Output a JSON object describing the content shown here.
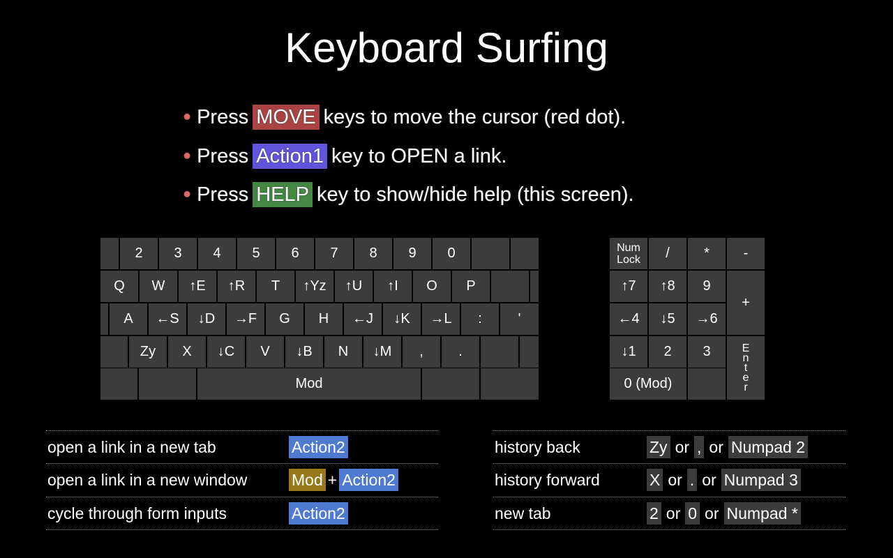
{
  "title": "Keyboard Surfing",
  "bullets": [
    {
      "prefix": "Press",
      "tag": "MOVE",
      "tag_color": "#aa4444",
      "suffix": "keys to move the cursor (red dot)."
    },
    {
      "prefix": "Press",
      "tag": "Action1",
      "tag_color": "#6155dd",
      "suffix": "key to OPEN a link."
    },
    {
      "prefix": "Press",
      "tag": "HELP",
      "tag_color": "#448844",
      "suffix": "key to show/hide help (this screen)."
    }
  ],
  "colors": {
    "move": "#aa4444",
    "action1": "#6155dd",
    "action2": "#4f7ad2",
    "help": "#448844",
    "history": "#8a8a00",
    "mod": "#987818",
    "default": "#3c3c3c"
  },
  "keyboard": {
    "row1": [
      "",
      "2",
      "3",
      "4",
      "5",
      "6",
      "7",
      "8",
      "9",
      "0",
      "",
      ""
    ],
    "row2": [
      "Q",
      "W",
      "↑E",
      "↑R",
      "T",
      "↑Yz",
      "↑U",
      "↑I",
      "O",
      "P",
      "",
      ""
    ],
    "row3": [
      "",
      "A",
      "←S",
      "↓D",
      "→F",
      "G",
      "H",
      "←J",
      "↓K",
      "→L",
      ":",
      "'"
    ],
    "row4": [
      "",
      "Zy",
      "X",
      "↓C",
      "V",
      "↓B",
      "N",
      "↓M",
      ",",
      ".",
      "",
      ""
    ],
    "row5": [
      "",
      "",
      "Mod",
      "",
      ""
    ]
  },
  "numpad": {
    "row1": [
      "Num\nLock",
      "/",
      "*",
      "-"
    ],
    "row2": [
      "↑7",
      "↑8",
      "9"
    ],
    "plus": "+",
    "row3": [
      "←4",
      "↓5",
      "→6"
    ],
    "row4": [
      "↓1",
      "2",
      "3"
    ],
    "enter": [
      "E",
      "n",
      "t",
      "e",
      "r"
    ],
    "row5": [
      "0 (Mod)",
      ""
    ]
  },
  "shortcuts_left": [
    {
      "action": "open a link in a new tab",
      "keys": [
        {
          "label": "Action2",
          "color": "#4f7ad2"
        }
      ]
    },
    {
      "action": "open a link in a new window",
      "keys": [
        {
          "label": "Mod",
          "color": "#987818"
        },
        {
          "sep": "+"
        },
        {
          "label": "Action2",
          "color": "#4f7ad2"
        }
      ]
    },
    {
      "action": "cycle through form inputs",
      "keys": [
        {
          "label": "Action2",
          "color": "#4f7ad2"
        }
      ]
    }
  ],
  "shortcuts_right": [
    {
      "action": "history back",
      "keys": [
        {
          "label": "Zy"
        },
        {
          "sep": "or"
        },
        {
          "label": ","
        },
        {
          "sep": "or"
        },
        {
          "label": "Numpad 2"
        }
      ]
    },
    {
      "action": "history forward",
      "keys": [
        {
          "label": "X"
        },
        {
          "sep": "or"
        },
        {
          "label": "."
        },
        {
          "sep": "or"
        },
        {
          "label": "Numpad 3"
        }
      ]
    },
    {
      "action": "new tab",
      "keys": [
        {
          "label": "2"
        },
        {
          "sep": "or"
        },
        {
          "label": "0"
        },
        {
          "sep": "or"
        },
        {
          "label": "Numpad *"
        }
      ]
    }
  ]
}
